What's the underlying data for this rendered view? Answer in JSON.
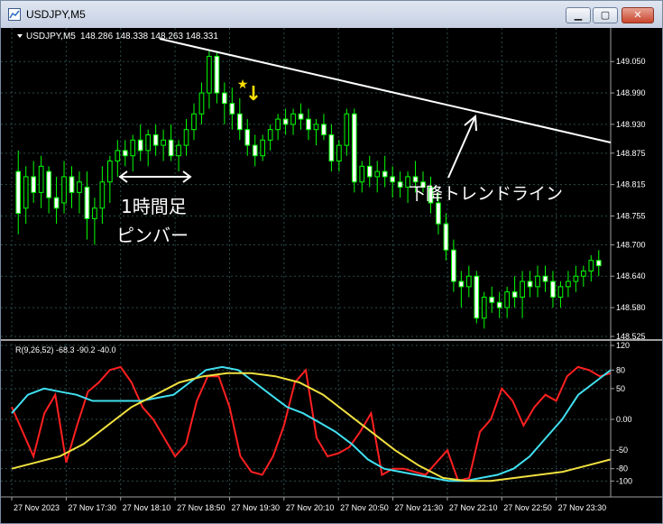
{
  "window": {
    "title": "USDJPY,M5"
  },
  "window_controls": {
    "minimize": "▁",
    "maximize": "▢",
    "close": "✕"
  },
  "annotations": {
    "star": "★",
    "arrow": "↓",
    "pinbar_line1": "1時間足",
    "pinbar_line2": "ピンバー",
    "trendline_label": "下降トレンドライン"
  },
  "colors": {
    "background": "#000000",
    "grid": "#2b4b4b",
    "candle": "#00ff00",
    "trendline": "#ffffff",
    "marker": "#ffe000",
    "rci_short": "#ff2020",
    "rci_mid": "#40e0f0",
    "rci_long": "#f0e040"
  },
  "chart_data": [
    {
      "type": "candlestick",
      "header": "USDJPY,M5  148.286 148.338 148.263 148.331",
      "symbol_label": "USDJPY,M5",
      "ohlc_label": "148.286 148.338 148.263 148.331",
      "ylim": [
        148.525,
        149.09
      ],
      "y_ticks": [
        "149.050",
        "148.990",
        "148.930",
        "148.875",
        "148.815",
        "148.755",
        "148.700",
        "148.640",
        "148.580",
        "148.525"
      ],
      "x_tick_labels": [
        "27 Nov 2023",
        "27 Nov 17:30",
        "27 Nov 18:10",
        "27 Nov 18:50",
        "27 Nov 19:30",
        "27 Nov 20:10",
        "27 Nov 20:50",
        "27 Nov 21:30",
        "27 Nov 22:10",
        "27 Nov 22:50",
        "27 Nov 23:30"
      ],
      "series": [
        {
          "values": [
            [
              148.84,
              148.88,
              148.72,
              148.76
            ],
            [
              148.77,
              148.85,
              148.74,
              148.83
            ],
            [
              148.83,
              148.86,
              148.78,
              148.8
            ],
            [
              148.8,
              148.87,
              148.77,
              148.85
            ],
            [
              148.84,
              148.85,
              148.76,
              148.79
            ],
            [
              148.79,
              148.83,
              148.74,
              148.77
            ],
            [
              148.78,
              148.86,
              148.76,
              148.83
            ],
            [
              148.83,
              148.85,
              148.77,
              148.8
            ],
            [
              148.8,
              148.84,
              148.76,
              148.82
            ],
            [
              148.81,
              148.84,
              148.71,
              148.75
            ],
            [
              148.75,
              148.79,
              148.7,
              148.77
            ],
            [
              148.77,
              148.85,
              148.74,
              148.82
            ],
            [
              148.82,
              148.87,
              148.78,
              148.86
            ],
            [
              148.86,
              148.9,
              148.83,
              148.88
            ],
            [
              148.88,
              148.9,
              148.85,
              148.87
            ],
            [
              148.87,
              148.91,
              148.84,
              148.9
            ],
            [
              148.9,
              148.93,
              148.86,
              148.88
            ],
            [
              148.88,
              148.92,
              148.85,
              148.91
            ],
            [
              148.91,
              148.93,
              148.87,
              148.89
            ],
            [
              148.89,
              148.92,
              148.86,
              148.9
            ],
            [
              148.9,
              148.93,
              148.86,
              148.87
            ],
            [
              148.87,
              148.9,
              148.84,
              148.89
            ],
            [
              148.89,
              148.94,
              148.87,
              148.92
            ],
            [
              148.92,
              148.97,
              148.9,
              148.95
            ],
            [
              148.95,
              149.01,
              148.93,
              148.99
            ],
            [
              148.99,
              149.07,
              148.96,
              149.06
            ],
            [
              149.06,
              149.07,
              148.97,
              148.99
            ],
            [
              148.99,
              149.01,
              148.93,
              148.97
            ],
            [
              148.97,
              149.0,
              148.92,
              148.95
            ],
            [
              148.95,
              148.98,
              148.9,
              148.92
            ],
            [
              148.92,
              148.94,
              148.87,
              148.89
            ],
            [
              148.89,
              148.91,
              148.85,
              148.87
            ],
            [
              148.87,
              148.91,
              148.86,
              148.9
            ],
            [
              148.9,
              148.93,
              148.88,
              148.92
            ],
            [
              148.92,
              148.95,
              148.9,
              148.94
            ],
            [
              148.94,
              148.96,
              148.91,
              148.93
            ],
            [
              148.93,
              148.96,
              148.91,
              148.95
            ],
            [
              148.95,
              148.97,
              148.92,
              148.94
            ],
            [
              148.94,
              148.96,
              148.9,
              148.92
            ],
            [
              148.92,
              148.94,
              148.89,
              148.93
            ],
            [
              148.93,
              148.95,
              148.9,
              148.91
            ],
            [
              148.91,
              148.93,
              148.84,
              148.86
            ],
            [
              148.86,
              148.9,
              148.84,
              148.89
            ],
            [
              148.89,
              148.96,
              148.87,
              148.95
            ],
            [
              148.95,
              148.96,
              148.8,
              148.82
            ],
            [
              148.82,
              148.86,
              148.8,
              148.85
            ],
            [
              148.85,
              148.87,
              148.81,
              148.83
            ],
            [
              148.83,
              148.86,
              148.8,
              148.84
            ],
            [
              148.84,
              148.87,
              148.81,
              148.83
            ],
            [
              148.83,
              148.85,
              148.79,
              148.82
            ],
            [
              148.82,
              148.84,
              148.79,
              148.81
            ],
            [
              148.81,
              148.84,
              148.78,
              148.83
            ],
            [
              148.83,
              148.86,
              148.8,
              148.82
            ],
            [
              148.82,
              148.84,
              148.8,
              148.81
            ],
            [
              148.81,
              148.83,
              148.76,
              148.78
            ],
            [
              148.78,
              148.8,
              148.72,
              148.74
            ],
            [
              148.74,
              148.76,
              148.67,
              148.69
            ],
            [
              148.69,
              148.71,
              148.61,
              148.63
            ],
            [
              148.63,
              148.65,
              148.58,
              148.62
            ],
            [
              148.62,
              148.66,
              148.6,
              148.64
            ],
            [
              148.64,
              148.65,
              148.55,
              148.56
            ],
            [
              148.56,
              148.61,
              148.54,
              148.6
            ],
            [
              148.6,
              148.62,
              148.57,
              148.59
            ],
            [
              148.59,
              148.61,
              148.56,
              148.58
            ],
            [
              148.58,
              148.62,
              148.56,
              148.61
            ],
            [
              148.61,
              148.64,
              148.58,
              148.6
            ],
            [
              148.6,
              148.65,
              148.56,
              148.63
            ],
            [
              148.63,
              148.65,
              148.6,
              148.62
            ],
            [
              148.62,
              148.66,
              148.6,
              148.64
            ],
            [
              148.64,
              148.66,
              148.61,
              148.63
            ],
            [
              148.63,
              148.65,
              148.58,
              148.6
            ],
            [
              148.6,
              148.63,
              148.58,
              148.62
            ],
            [
              148.62,
              148.65,
              148.6,
              148.63
            ],
            [
              148.63,
              148.66,
              148.61,
              148.64
            ],
            [
              148.64,
              148.66,
              148.62,
              148.65
            ],
            [
              148.65,
              148.68,
              148.63,
              148.67
            ],
            [
              148.67,
              148.69,
              148.64,
              148.66
            ]
          ]
        }
      ]
    },
    {
      "type": "line",
      "title": "R(9,26,52) -68.3 -90.2 -40.0",
      "ylim": [
        -120,
        120
      ],
      "y_ticks": [
        "120",
        "80",
        "50",
        "0.00",
        "-50",
        "-80",
        "-100"
      ],
      "series": [
        {
          "name": "9",
          "values": [
            20,
            -20,
            -60,
            10,
            40,
            -70,
            -10,
            45,
            60,
            80,
            85,
            60,
            20,
            0,
            -30,
            -60,
            -40,
            30,
            70,
            70,
            20,
            -60,
            -85,
            -90,
            -60,
            -10,
            60,
            80,
            -30,
            -60,
            -55,
            -45,
            -20,
            10,
            -90,
            -80,
            -80,
            -85,
            -90,
            -70,
            -50,
            -100,
            -95,
            -20,
            0,
            50,
            30,
            -10,
            20,
            40,
            30,
            70,
            85,
            80,
            70,
            75
          ]
        },
        {
          "name": "26",
          "values": [
            10,
            40,
            50,
            45,
            40,
            30,
            30,
            30,
            30,
            35,
            40,
            60,
            80,
            85,
            80,
            60,
            40,
            20,
            10,
            -5,
            -20,
            -40,
            -65,
            -80,
            -85,
            -90,
            -95,
            -100,
            -100,
            -95,
            -90,
            -80,
            -60,
            -30,
            0,
            40,
            60,
            80
          ]
        },
        {
          "name": "52",
          "values": [
            -80,
            -70,
            -60,
            -40,
            -10,
            20,
            40,
            60,
            70,
            75,
            75,
            70,
            60,
            40,
            10,
            -20,
            -50,
            -75,
            -95,
            -100,
            -100,
            -95,
            -90,
            -85,
            -75,
            -65
          ]
        }
      ]
    }
  ]
}
